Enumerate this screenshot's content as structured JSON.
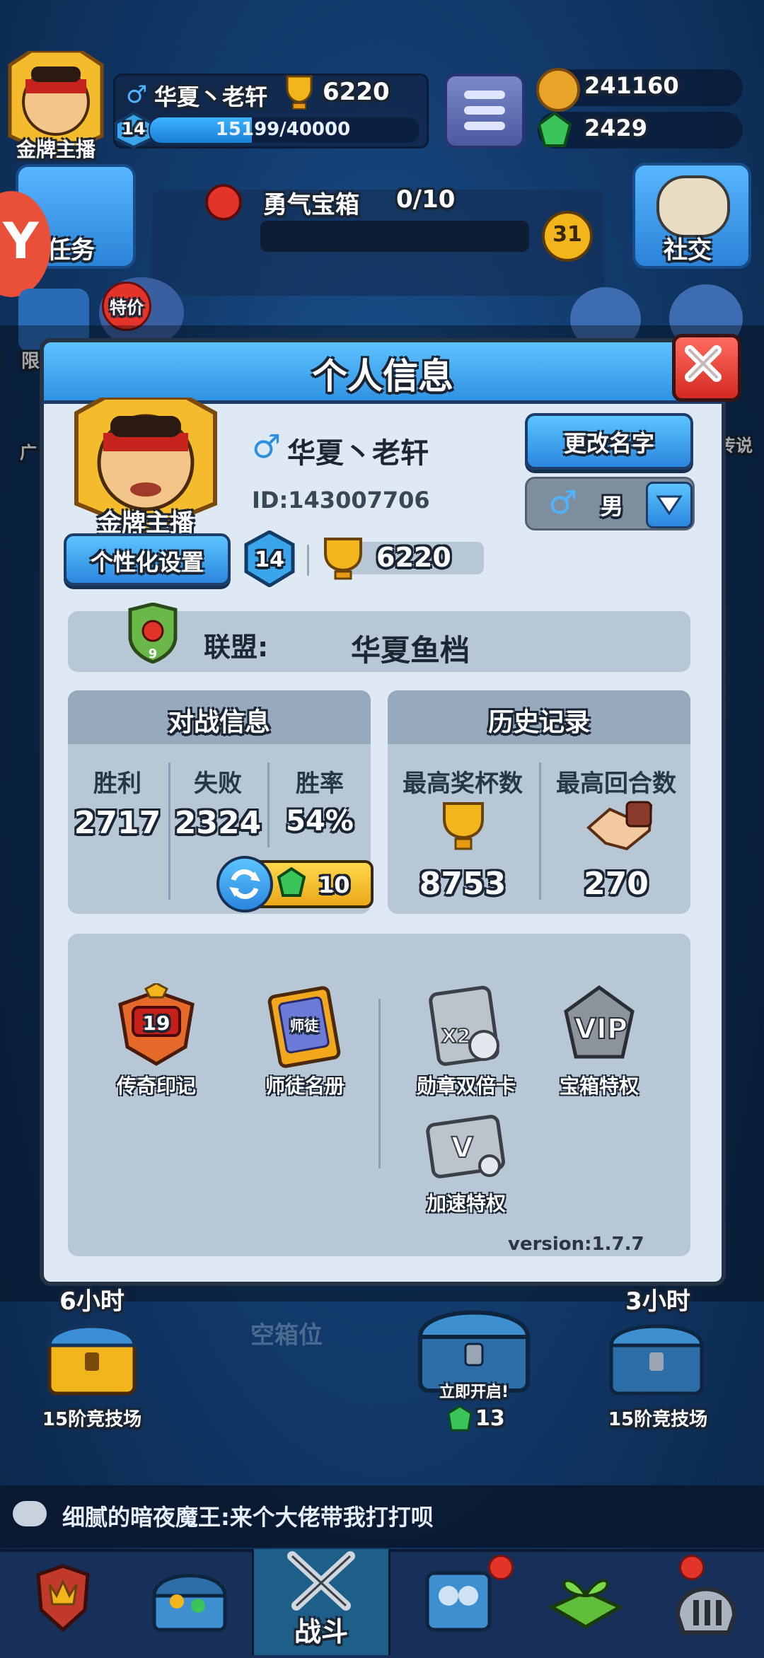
{
  "hud": {
    "avatar_badge": "金牌主播",
    "player_name": "华夏丶老轩",
    "level": "14",
    "trophies": "6220",
    "xp": "15199/40000",
    "xp_fraction": 0.38,
    "gold": "241160",
    "gems": "2429",
    "left_button": "任务",
    "right_button": "社交",
    "chest_title": "勇气宝箱",
    "chest_progress": "0/10",
    "chest_badge": "31",
    "promo_tag": "特价",
    "side_left_1": "限",
    "side_left_2": "广",
    "side_right": "传说"
  },
  "modal": {
    "title": "个人信息",
    "close_icon": "close-icon",
    "avatar_badge": "金牌主播",
    "name": "华夏丶老轩",
    "player_id": "ID:143007706",
    "rename_button": "更改名字",
    "gender": "男",
    "customize_button": "个性化设置",
    "level": "14",
    "trophies": "6220",
    "alliance_label": "联盟:",
    "alliance_name": "华夏鱼档",
    "alliance_level": "9",
    "battle": {
      "title": "对战信息",
      "columns": [
        {
          "label": "胜利",
          "value": "2717"
        },
        {
          "label": "失败",
          "value": "2324"
        },
        {
          "label": "胜率",
          "value": "54%"
        }
      ],
      "reset_cost": "10"
    },
    "history": {
      "title": "历史记录",
      "max_trophies_label": "最高奖杯数",
      "max_trophies": "8753",
      "max_rounds_label": "最高回合数",
      "max_rounds": "270"
    },
    "perks": {
      "legend_mark": "传奇印记",
      "legend_level": "19",
      "mentor_book": "师徒名册",
      "mentor_tag": "师徒",
      "medal_double": "勋章双倍卡",
      "chest_privilege": "宝箱特权",
      "speed_privilege": "加速特权"
    },
    "version": "version:1.7.7"
  },
  "bottom": {
    "slot1_time": "6小时",
    "slot1_label": "15阶竞技场",
    "slot2_label": "空箱位",
    "slot3_action": "立即开启!",
    "slot3_cost": "13",
    "slot4_time": "3小时",
    "slot4_label": "15阶竞技场",
    "chat_message": "细腻的暗夜魔王:来个大佬带我打打呗",
    "nav_center": "战斗"
  },
  "colors": {
    "accent_blue": "#2f93e4",
    "close_red": "#d42a22",
    "gold": "#f2b51b",
    "gem_green": "#3bc45a"
  }
}
